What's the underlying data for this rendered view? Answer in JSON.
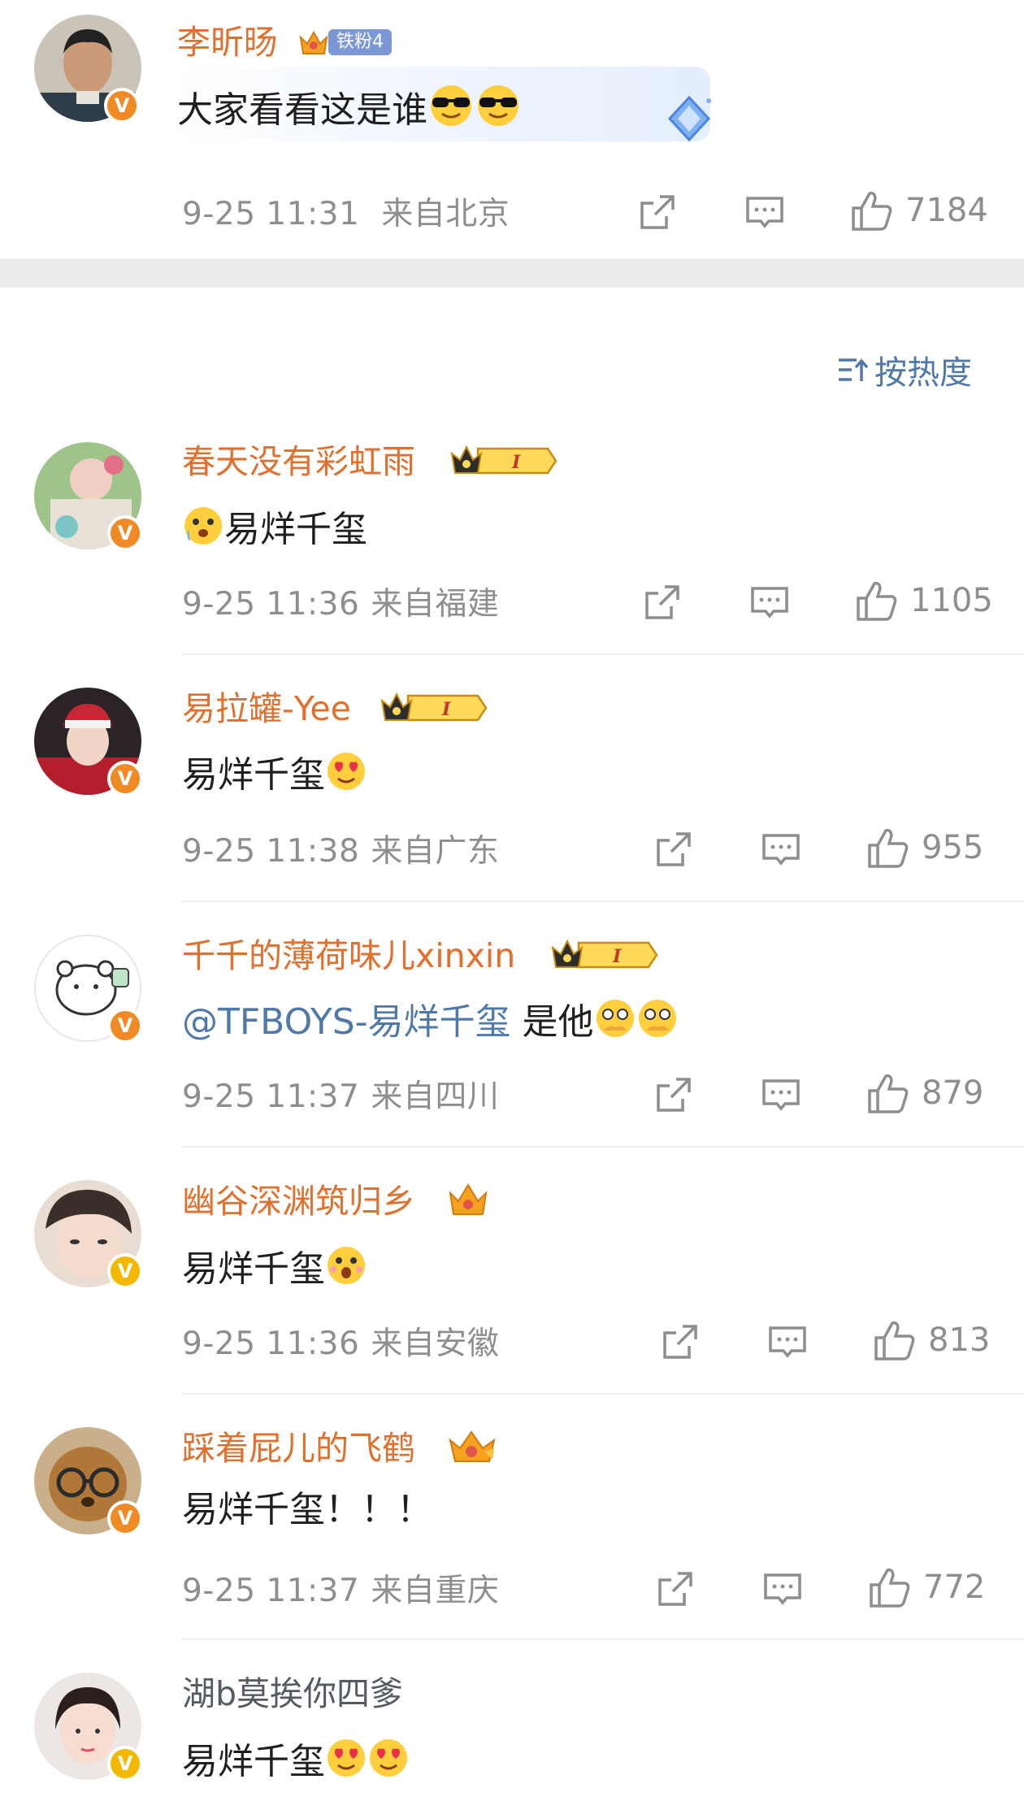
{
  "post": {
    "author": "李昕旸",
    "fan_badge": "铁粉4",
    "text": "大家看看这是谁",
    "time": "9-25 11:31",
    "location": "来自北京",
    "likes": "7184"
  },
  "sort": {
    "label": "按热度",
    "icon": "sort-lines-icon"
  },
  "comments": [
    {
      "name": "春天没有彩虹雨",
      "text": "易烊千玺",
      "time": "9-25 11:36",
      "location": "来自福建",
      "likes": "1105"
    },
    {
      "name": "易拉罐-Yee",
      "text": "易烊千玺",
      "time": "9-25 11:38",
      "location": "来自广东",
      "likes": "955"
    },
    {
      "name": "千千的薄荷味儿xinxin",
      "mention": "@TFBOYS-易烊千玺",
      "text": " 是他",
      "time": "9-25 11:37",
      "location": "来自四川",
      "likes": "879"
    },
    {
      "name": "幽谷深渊筑归乡",
      "text": "易烊千玺",
      "time": "9-25 11:36",
      "location": "来自安徽",
      "likes": "813"
    },
    {
      "name": "踩着屁儿的飞鹤",
      "text": "易烊千玺！！！",
      "time": "9-25 11:37",
      "location": "来自重庆",
      "likes": "772"
    },
    {
      "name": "湖b莫挨你四爹",
      "text": "易烊千玺"
    }
  ],
  "member_badge_text": "I",
  "colors": {
    "username_orange": "#e36f2d",
    "mention_blue": "#4f79a8",
    "meta_gray": "#8e8e8e",
    "verified_orange": "#f08a24",
    "verified_yellow": "#f5b800",
    "divider_band": "#ececec"
  }
}
